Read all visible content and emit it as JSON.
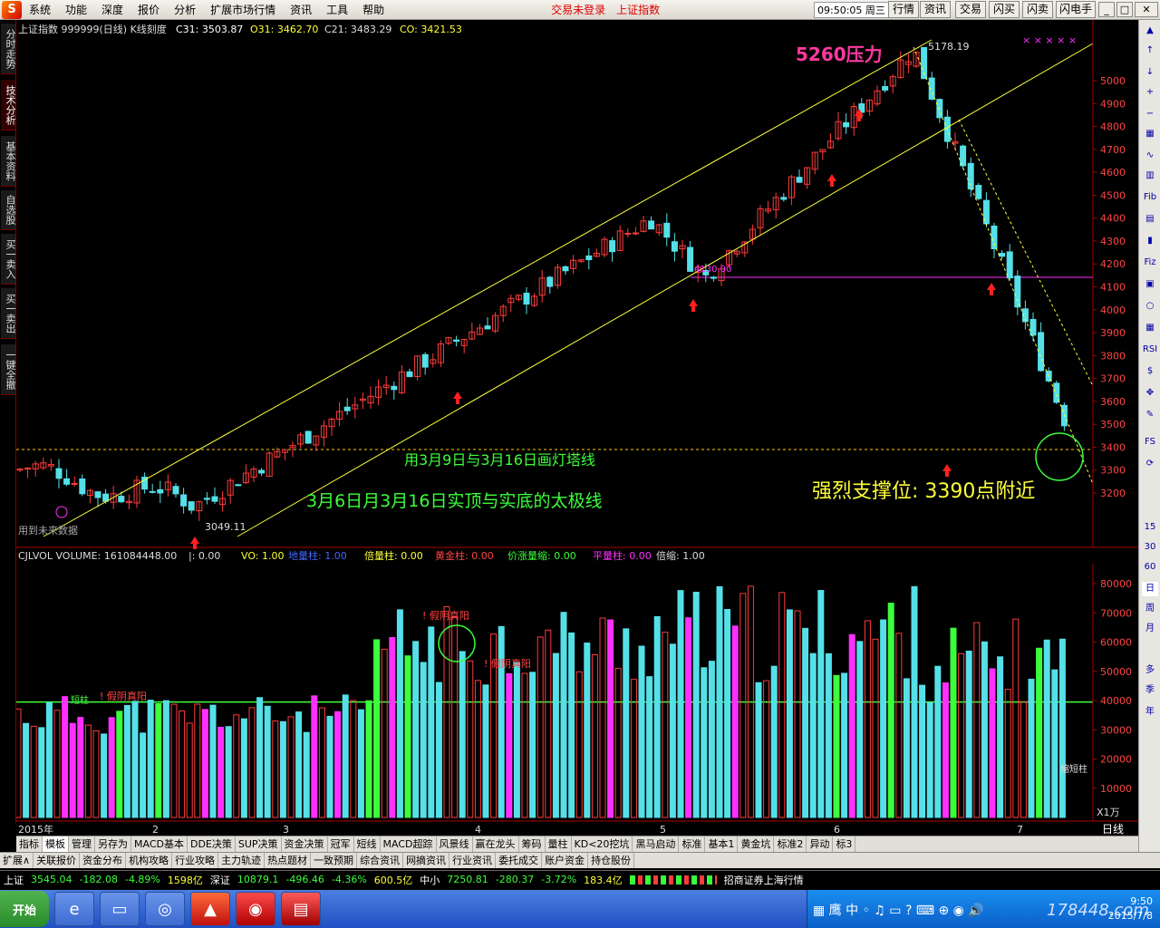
{
  "menu": {
    "logo": "S",
    "items": [
      "系统",
      "功能",
      "深度",
      "报价",
      "分析",
      "扩展市场行情",
      "资讯",
      "工具",
      "帮助"
    ],
    "status1": "交易未登录",
    "status2": "上证指数",
    "clock": "09:50:05 周三",
    "buttons": [
      "行情",
      "资讯",
      "交易",
      "闪买",
      "闪卖",
      "闪电手"
    ]
  },
  "left_tabs": [
    "分时走势",
    "技术分析",
    "基本资料",
    "自选股",
    "买一卖入",
    "买一卖出",
    "一键全撤"
  ],
  "chart_header": {
    "name": "上证指数 999999(日线) K线刻度",
    "c31": "C31: 3503.87",
    "o31": "O31: 3462.70",
    "c21": "C21: 3483.29",
    "co": "CO: 3421.53"
  },
  "price_axis": [
    "5000",
    "4900",
    "4800",
    "4700",
    "4600",
    "4500",
    "4400",
    "4300",
    "4200",
    "4100",
    "4000",
    "3900",
    "3800",
    "3700",
    "3600",
    "3500",
    "3400",
    "3300",
    "3200"
  ],
  "annotations": {
    "resist": "5260压力",
    "high": "5178.19",
    "low": "3049.11",
    "line_label": "4130.00",
    "tower_line": "用3月9日与3月16日画灯塔线",
    "taiji_line": "3月6日月3月16日实顶与实底的太极线",
    "support": "强烈支撑位:  3390点附近",
    "future": "用到未来数据"
  },
  "vol_header": {
    "a": "CJLVOL VOLUME: 161084448.00",
    "b": "|: 0.00",
    "c": "VO: 1.00",
    "d": "地量柱: 1.00",
    "e": "倍量柱: 0.00",
    "f": "黄金柱: 0.00",
    "g": "价涨量缩: 0.00",
    "h": "平量柱: 0.00",
    "i": "倍缩: 1.00"
  },
  "vol_axis": [
    "80000",
    "70000",
    "60000",
    "50000",
    "40000",
    "30000",
    "20000",
    "10000"
  ],
  "vol_annotations": {
    "fake1": "! 假阴真阳",
    "fake2": "! 假阴真阳",
    "fake3": "! 假阴真阳",
    "short1": "短柱",
    "short2": "缩短柱",
    "unit": "X1万"
  },
  "date_axis": [
    "2015年",
    "2",
    "3",
    "4",
    "5",
    "6",
    "7"
  ],
  "timeframe": "日线",
  "tabs": [
    "指标",
    "模板",
    "管理",
    "另存为",
    "MACD基本",
    "DDE决策",
    "SUP决策",
    "资金决策",
    "冠军",
    "短线",
    "MACD超踪",
    "风景线",
    "赢在龙头",
    "筹码",
    "量柱",
    "KD<20挖坑",
    "黑马启动",
    "标准",
    "基本1",
    "黄金坑",
    "标准2",
    "异动",
    "标3"
  ],
  "tabs2": [
    "扩展∧",
    "关联报价",
    "资金分布",
    "机构攻略",
    "行业攻略",
    "主力轨迹",
    "热点题材",
    "一致预期",
    "综合资讯",
    "网摘资讯",
    "行业资讯",
    "委托成交",
    "账户资金",
    "持仓股份"
  ],
  "status": [
    {
      "name": "上证",
      "price": "3545.04",
      "chg": "-182.08",
      "pct": "-4.89%",
      "amt": "1598亿"
    },
    {
      "name": "深证",
      "price": "10879.1",
      "chg": "-496.46",
      "pct": "-4.36%",
      "amt": "600.5亿"
    },
    {
      "name": "中小",
      "price": "7250.81",
      "chg": "-280.37",
      "pct": "-3.72%",
      "amt": "183.4亿"
    }
  ],
  "broker": "招商证券上海行情",
  "taskbar": {
    "start": "开始",
    "clock": "9:50",
    "date": "2015/7/8",
    "watermark": "178448.com"
  },
  "right_periods": [
    "15",
    "30",
    "60",
    "日",
    "周",
    "月",
    "多",
    "季",
    "年"
  ],
  "chart_data": {
    "type": "candlestick",
    "title": "上证指数 999999(日线)",
    "ohlc_samples": {
      "high": 5178.19,
      "low": 3049.11,
      "last": 3503.87
    },
    "support": 3390,
    "resistance": 5260
  },
  "colors": {
    "up": "#ff3b3b",
    "down": "#55e0e8",
    "bg": "#000000",
    "yellowline": "#ffff3a",
    "magenta": "#ff30ff",
    "green": "#3cff3c"
  }
}
